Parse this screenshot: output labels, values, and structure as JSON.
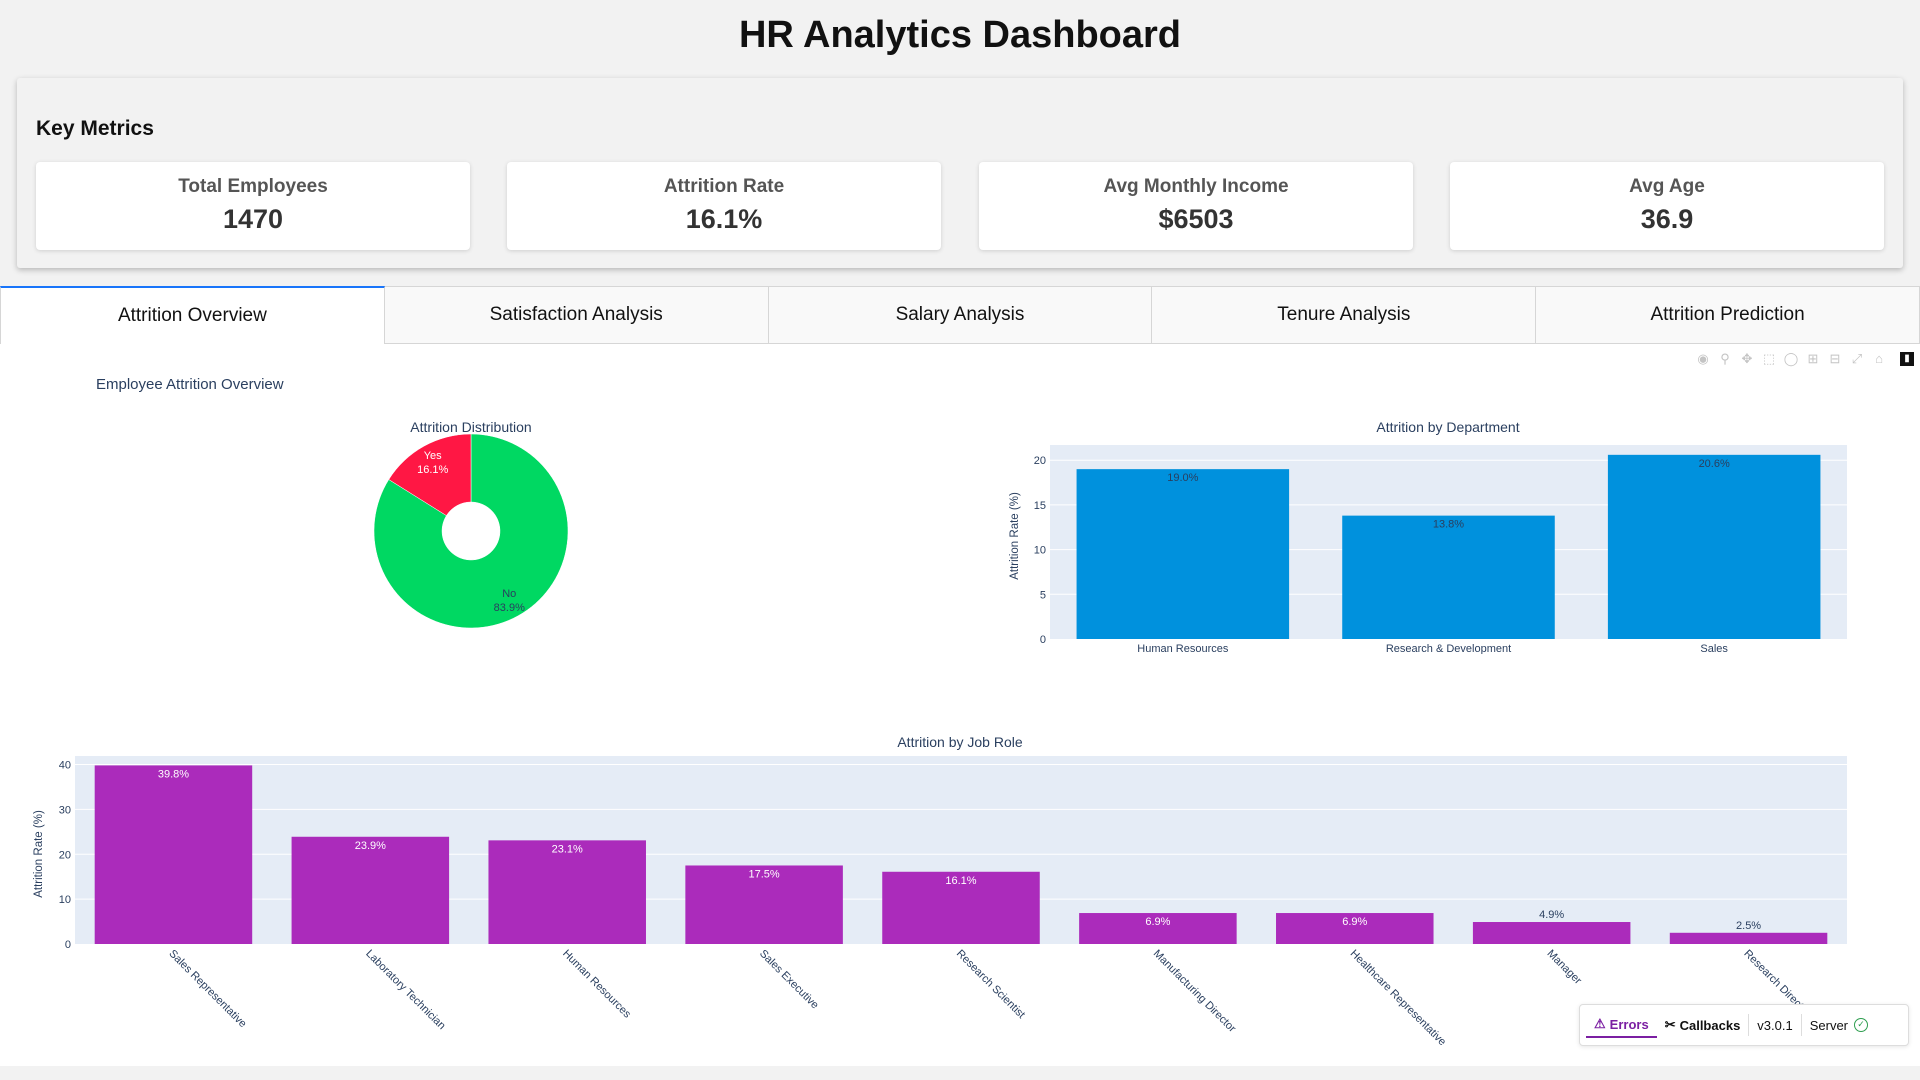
{
  "page_title": "HR Analytics Dashboard",
  "key_metrics": {
    "title": "Key Metrics",
    "cards": [
      {
        "label": "Total Employees",
        "value": "1470"
      },
      {
        "label": "Attrition Rate",
        "value": "16.1%"
      },
      {
        "label": "Avg Monthly Income",
        "value": "$6503"
      },
      {
        "label": "Avg Age",
        "value": "36.9"
      }
    ]
  },
  "tabs": [
    {
      "label": "Attrition Overview",
      "active": true
    },
    {
      "label": "Satisfaction Analysis",
      "active": false
    },
    {
      "label": "Salary Analysis",
      "active": false
    },
    {
      "label": "Tenure Analysis",
      "active": false
    },
    {
      "label": "Attrition Prediction",
      "active": false
    }
  ],
  "overview_title": "Employee Attrition Overview",
  "modebar_icons": [
    "camera-icon",
    "zoom-icon",
    "pan-icon",
    "box-select-icon",
    "lasso-icon",
    "zoom-in-icon",
    "zoom-out-icon",
    "autoscale-icon",
    "reset-axes-icon",
    "plotly-logo-icon"
  ],
  "colors": {
    "pie_no": "#00d862",
    "pie_yes": "#ff1744",
    "dept_bar": "#0091dd",
    "role_bar": "#ab2bbb",
    "plot_bg": "#e5ecf6",
    "text": "#2a3f5f",
    "active_tab": "#1975fa"
  },
  "chart_data": [
    {
      "type": "pie",
      "title": "Attrition Distribution",
      "hole": true,
      "slices": [
        {
          "label": "No",
          "value": 83.9,
          "text": "83.9%"
        },
        {
          "label": "Yes",
          "value": 16.1,
          "text": "16.1%"
        }
      ]
    },
    {
      "type": "bar",
      "title": "Attrition by Department",
      "xlabel": "",
      "ylabel": "Attrition Rate (%)",
      "categories": [
        "Human Resources",
        "Research & Development",
        "Sales"
      ],
      "values": [
        19.0,
        13.8,
        20.6
      ],
      "labels": [
        "19.0%",
        "13.8%",
        "20.6%"
      ],
      "yticks": [
        0,
        5,
        10,
        15,
        20
      ],
      "ylim": [
        0,
        21.7
      ]
    },
    {
      "type": "bar",
      "title": "Attrition by Job Role",
      "xlabel": "",
      "ylabel": "Attrition Rate (%)",
      "categories": [
        "Sales Representative",
        "Laboratory Technician",
        "Human Resources",
        "Sales Executive",
        "Research Scientist",
        "Manufacturing Director",
        "Healthcare Representative",
        "Manager",
        "Research Director"
      ],
      "values": [
        39.8,
        23.9,
        23.1,
        17.5,
        16.1,
        6.9,
        6.9,
        4.9,
        2.5
      ],
      "labels": [
        "39.8%",
        "23.9%",
        "23.1%",
        "17.5%",
        "16.1%",
        "6.9%",
        "6.9%",
        "4.9%",
        "2.5%"
      ],
      "yticks": [
        0,
        10,
        20,
        30,
        40
      ],
      "ylim": [
        0,
        41.9
      ]
    }
  ],
  "debug_bar": {
    "errors": "Errors",
    "callbacks": "Callbacks",
    "version": "v3.0.1",
    "server": "Server"
  }
}
